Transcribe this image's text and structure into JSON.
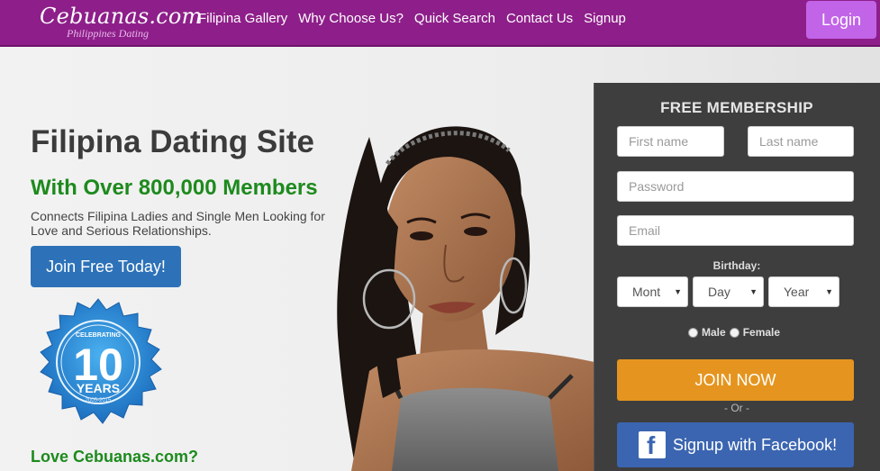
{
  "header": {
    "logo": "Cebuanas.com",
    "logo_tagline": "Philippines Dating",
    "nav": [
      "Filipina Gallery",
      "Why Choose Us?",
      "Quick Search",
      "Contact Us",
      "Signup"
    ],
    "login_label": "Login"
  },
  "hero": {
    "title": "Filipina Dating Site",
    "subtitle": "With Over 800,000 Members",
    "description": "Connects Filipina Ladies and Single Men Looking for Love and Serious Relationships.",
    "cta_label": "Join Free Today!",
    "badge": {
      "top": "CELEBRATING",
      "number": "10",
      "bottom": "YEARS",
      "year": "2005-2015"
    },
    "love_text": "Love Cebuanas.com?"
  },
  "signup": {
    "title": "FREE MEMBERSHIP",
    "first_name_placeholder": "First name",
    "last_name_placeholder": "Last name",
    "password_placeholder": "Password",
    "email_placeholder": "Email",
    "birthday_label": "Birthday:",
    "month": "Mont",
    "day": "Day",
    "year": "Year",
    "male": "Male",
    "female": "Female",
    "join_label": "JOIN NOW",
    "or_text": "- Or -",
    "facebook_label": "Signup with Facebook!"
  },
  "colors": {
    "header": "#8e1f8a",
    "login": "#c264e8",
    "cta_blue": "#2d72b8",
    "green": "#1d8a1d",
    "panel": "#3e3e3e",
    "join_orange": "#e5951f",
    "facebook": "#3b65b0"
  },
  "icons": [
    "facebook-icon",
    "anniversary-badge-icon"
  ]
}
